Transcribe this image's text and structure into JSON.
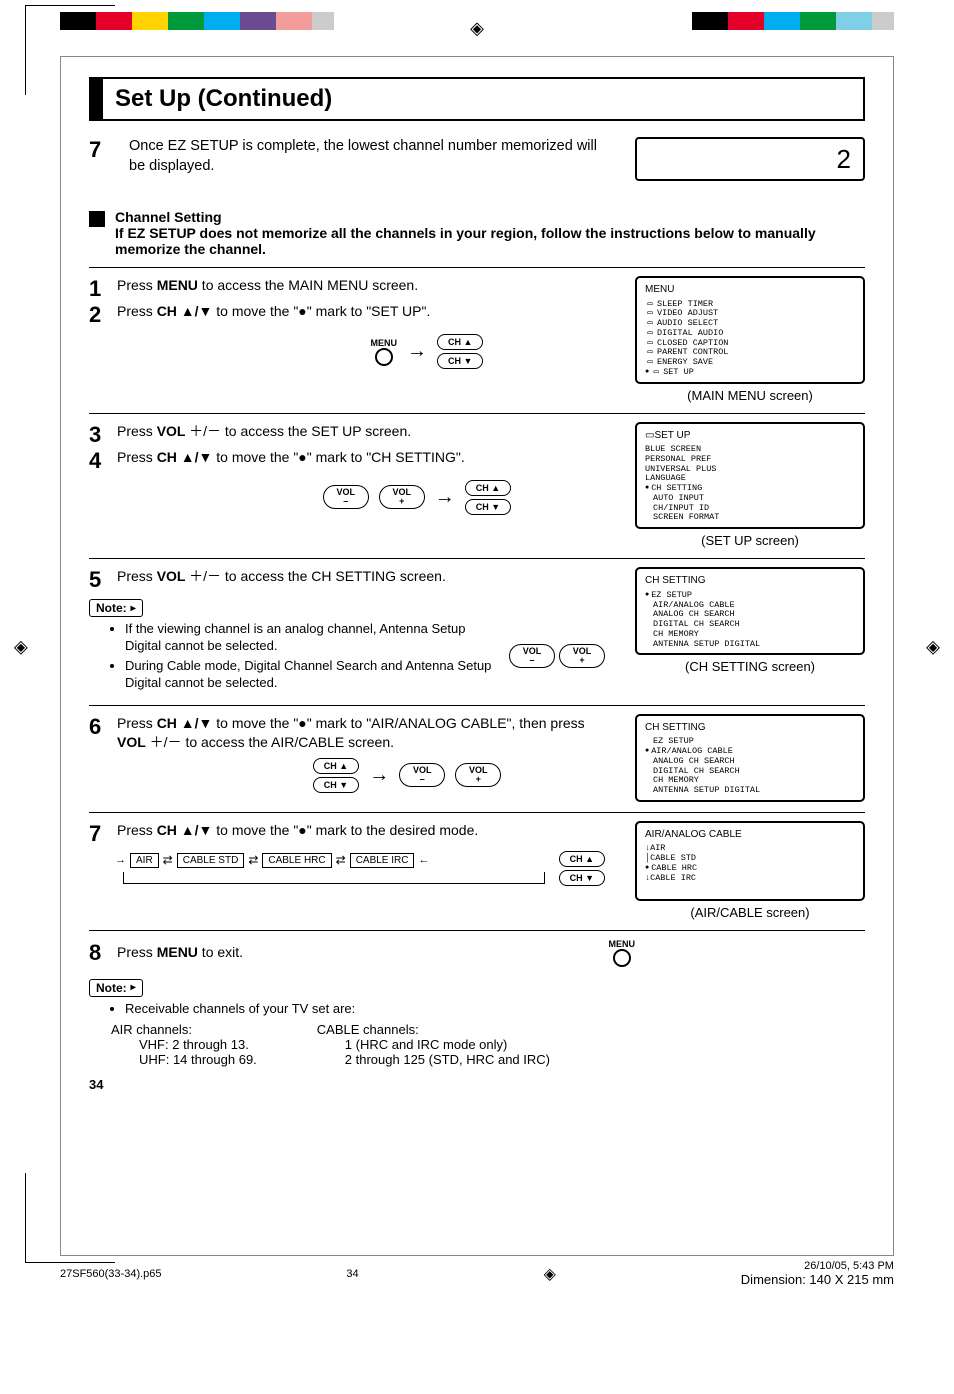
{
  "title": "Set Up (Continued)",
  "intro": {
    "num": "7",
    "text": "Once EZ SETUP is complete, the lowest channel number memorized will be displayed.",
    "display_value": "2"
  },
  "ch_setting_heading": {
    "title": "Channel Setting",
    "sub": "If EZ SETUP does not memorize all the channels in your region, follow the instructions below to manually memorize the channel."
  },
  "step1": {
    "num": "1",
    "text_a": "Press ",
    "text_b": "MENU",
    "text_c": " to access the MAIN MENU screen."
  },
  "step2": {
    "num": "2",
    "text_a": "Press ",
    "text_b": "CH ▲/▼",
    "text_c": " to move the \"●\" mark to \"SET UP\"."
  },
  "osd_main": {
    "title": "MENU",
    "items": [
      "SLEEP TIMER",
      "VIDEO ADJUST",
      "AUDIO SELECT",
      "DIGITAL AUDIO",
      "CLOSED CAPTION",
      "PARENT CONTROL",
      "ENERGY SAVE",
      "SET UP"
    ],
    "caption": "(MAIN MENU screen)"
  },
  "step3": {
    "num": "3",
    "text_a": "Press ",
    "text_b": "VOL ",
    "text_c": "＋/－  to access the SET UP screen."
  },
  "step4": {
    "num": "4",
    "text_a": "Press ",
    "text_b": "CH ▲/▼",
    "text_c": " to move the \"●\" mark to \"CH SETTING\"."
  },
  "osd_setup": {
    "title": "SET UP",
    "items": [
      "BLUE SCREEN",
      "PERSONAL PREF",
      "UNIVERSAL PLUS",
      "LANGUAGE",
      "CH SETTING",
      "AUTO INPUT",
      "CH/INPUT ID",
      "SCREEN FORMAT"
    ],
    "caption": "(SET UP screen)"
  },
  "step5": {
    "num": "5",
    "text_a": "Press ",
    "text_b": "VOL ",
    "text_c": "＋/－  to access the CH SETTING screen."
  },
  "note1": {
    "label": "Note:",
    "li1": "If the viewing channel is an analog channel, Antenna Setup Digital cannot be selected.",
    "li2": "During Cable mode, Digital Channel Search and Antenna Setup Digital cannot be selected."
  },
  "osd_chset": {
    "title": "CH SETTING",
    "items": [
      "EZ SETUP",
      "AIR/ANALOG CABLE",
      "ANALOG CH SEARCH",
      "DIGITAL CH SEARCH",
      "CH MEMORY",
      "ANTENNA SETUP DIGITAL"
    ],
    "caption": "(CH SETTING screen)"
  },
  "step6": {
    "num": "6",
    "line1": "Press CH ▲/▼ to move the \"●\" mark to \"AIR/ANALOG CABLE\", then press VOL ＋/－  to access the AIR/CABLE screen."
  },
  "osd_chset2": {
    "title": "CH SETTING",
    "items": [
      "EZ SETUP",
      "AIR/ANALOG CABLE",
      "ANALOG CH SEARCH",
      "DIGITAL CH SEARCH",
      "CH MEMORY",
      "ANTENNA SETUP DIGITAL"
    ],
    "caption": ""
  },
  "step7": {
    "num": "7",
    "text": "Press CH ▲/▼ to move the \"●\" mark to the desired mode.",
    "modes": [
      "AIR",
      "CABLE STD",
      "CABLE HRC",
      "CABLE IRC"
    ]
  },
  "osd_aircable": {
    "title": "AIR/ANALOG CABLE",
    "items": [
      "AIR",
      "CABLE STD",
      "CABLE HRC",
      "CABLE IRC"
    ],
    "caption": "(AIR/CABLE screen)"
  },
  "step8": {
    "num": "8",
    "text_a": "Press ",
    "text_b": "MENU",
    "text_c": " to exit."
  },
  "note2": {
    "label": "Note:",
    "lead": "Receivable channels of your TV set are:",
    "air_h": "AIR channels:",
    "air_l1": "VHF: 2 through 13.",
    "air_l2": "UHF: 14 through 69.",
    "cab_h": "CABLE channels:",
    "cab_l1": "1 (HRC and IRC mode only)",
    "cab_l2": "2 through 125 (STD, HRC and IRC)"
  },
  "pagenum": "34",
  "footer": {
    "file": "27SF560(33-34).p65",
    "page": "34",
    "date": "26/10/05, 5:43 PM",
    "dim": "Dimension: 140  X 215 mm"
  },
  "btn": {
    "menu": "MENU",
    "cha": "CH ▲",
    "chv": "CH ▼",
    "volm": "VOL\n–",
    "volp": "VOL\n+"
  }
}
